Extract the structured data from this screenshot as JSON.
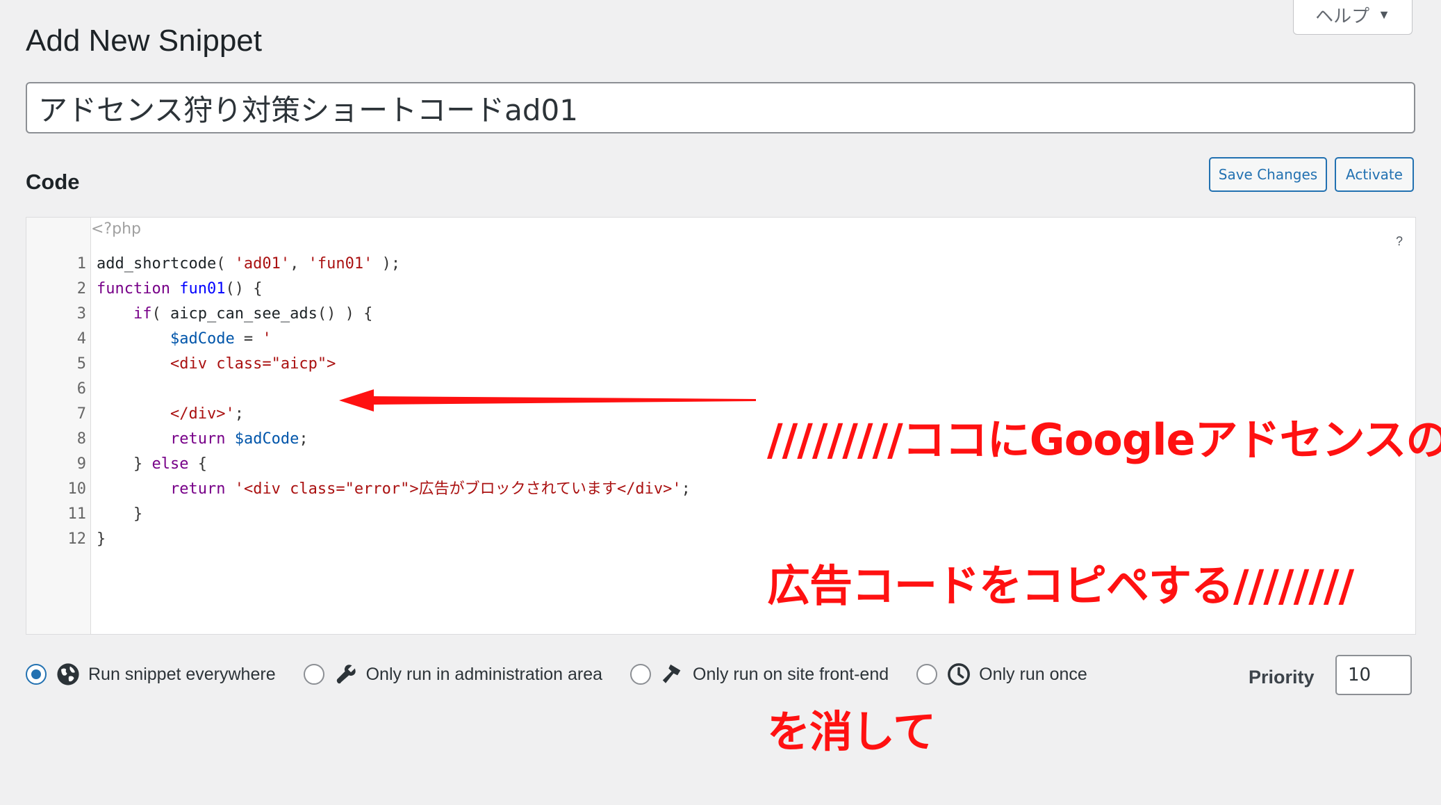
{
  "help_tab": {
    "label": "ヘルプ",
    "caret": "▼"
  },
  "page_title": "Add New Snippet",
  "snippet_title": {
    "value": "アドセンス狩り対策ショートコードad01"
  },
  "code_section": {
    "label": "Code"
  },
  "actions": {
    "save_label": "Save Changes",
    "activate_label": "Activate"
  },
  "editor": {
    "php_open": "<?php",
    "help_label": "?",
    "lines": [
      {
        "num": "1",
        "tokens": [
          {
            "t": "add_shortcode",
            "c": "plain"
          },
          {
            "t": "( ",
            "c": "pun"
          },
          {
            "t": "'ad01'",
            "c": "str"
          },
          {
            "t": ", ",
            "c": "pun"
          },
          {
            "t": "'fun01'",
            "c": "str"
          },
          {
            "t": " );",
            "c": "pun"
          }
        ]
      },
      {
        "num": "2",
        "tokens": [
          {
            "t": "function",
            "c": "key"
          },
          {
            "t": " ",
            "c": "plain"
          },
          {
            "t": "fun01",
            "c": "def"
          },
          {
            "t": "() {",
            "c": "pun"
          }
        ]
      },
      {
        "num": "3",
        "tokens": [
          {
            "t": "    ",
            "c": "plain"
          },
          {
            "t": "if",
            "c": "key"
          },
          {
            "t": "( ",
            "c": "pun"
          },
          {
            "t": "aicp_can_see_ads",
            "c": "plain"
          },
          {
            "t": "() ) {",
            "c": "pun"
          }
        ]
      },
      {
        "num": "4",
        "tokens": [
          {
            "t": "        ",
            "c": "plain"
          },
          {
            "t": "$adCode",
            "c": "var"
          },
          {
            "t": " = ",
            "c": "pun"
          },
          {
            "t": "'",
            "c": "str"
          }
        ]
      },
      {
        "num": "5",
        "tokens": [
          {
            "t": "        ",
            "c": "plain"
          },
          {
            "t": "<div class=\"aicp\">",
            "c": "str"
          }
        ]
      },
      {
        "num": "6",
        "tokens": []
      },
      {
        "num": "7",
        "tokens": [
          {
            "t": "        ",
            "c": "plain"
          },
          {
            "t": "</div>'",
            "c": "str"
          },
          {
            "t": ";",
            "c": "pun"
          }
        ]
      },
      {
        "num": "8",
        "tokens": [
          {
            "t": "        ",
            "c": "plain"
          },
          {
            "t": "return",
            "c": "key"
          },
          {
            "t": " ",
            "c": "plain"
          },
          {
            "t": "$adCode",
            "c": "var"
          },
          {
            "t": ";",
            "c": "pun"
          }
        ]
      },
      {
        "num": "9",
        "tokens": [
          {
            "t": "    } ",
            "c": "pun"
          },
          {
            "t": "else",
            "c": "key"
          },
          {
            "t": " {",
            "c": "pun"
          }
        ]
      },
      {
        "num": "10",
        "tokens": [
          {
            "t": "        ",
            "c": "plain"
          },
          {
            "t": "return",
            "c": "key"
          },
          {
            "t": " ",
            "c": "plain"
          },
          {
            "t": "'<div class=\"error\">広告がブロックされています</div>'",
            "c": "str"
          },
          {
            "t": ";",
            "c": "pun"
          }
        ]
      },
      {
        "num": "11",
        "tokens": [
          {
            "t": "    }",
            "c": "pun"
          }
        ]
      },
      {
        "num": "12",
        "tokens": [
          {
            "t": "}",
            "c": "pun"
          }
        ]
      }
    ]
  },
  "annotation": {
    "lines": [
      "/////////ココにGoogleアドセンスの",
      "広告コードをコピペする////////",
      "を消して"
    ],
    "color": "#ff1111"
  },
  "run_options": [
    {
      "label": "Run snippet everywhere",
      "icon": "globe-icon",
      "checked": true
    },
    {
      "label": "Only run in administration area",
      "icon": "wrench-icon",
      "checked": false
    },
    {
      "label": "Only run on site front-end",
      "icon": "hammer-icon",
      "checked": false
    },
    {
      "label": "Only run once",
      "icon": "clock-icon",
      "checked": false
    }
  ],
  "priority": {
    "label": "Priority",
    "value": "10"
  },
  "colors": {
    "accent": "#2271b1",
    "annotation": "#ff1111",
    "background": "#f0f0f1"
  }
}
